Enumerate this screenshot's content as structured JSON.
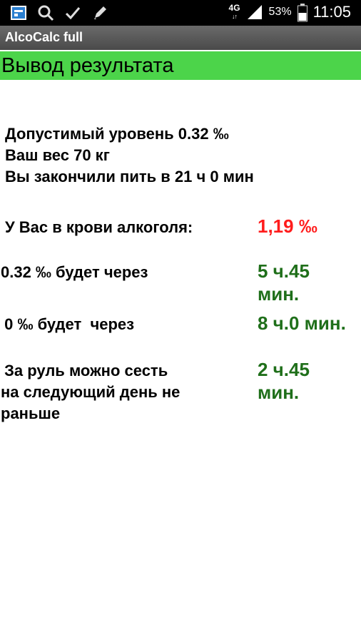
{
  "status_bar": {
    "network": "4G",
    "battery": "53%",
    "time": "11:05",
    "icons": [
      "screenshot-app-icon",
      "search-icon",
      "check-icon",
      "pen-icon",
      "signal-icon",
      "battery-icon"
    ]
  },
  "app": {
    "title": "AlcoCalc full"
  },
  "header": {
    "title": "Вывод результата"
  },
  "inputs_summary": {
    "limit": "Допустимый уровень 0.32  ‰",
    "weight": "Ваш вес 70 кг",
    "finished": "Вы закончили пить в 21 ч 0 мин"
  },
  "results": {
    "blood_label": "У Вас в крови  алкоголя:",
    "blood_value": "1,19  ‰",
    "limit_label": "0.32 ‰ будет  через",
    "limit_value_line1": "5 ч.45",
    "limit_value_line2": "мин.",
    "zero_label": " 0 ‰ будет  через",
    "zero_value": "8 ч.0 мин.",
    "drive_label_line1": " За руль можно сесть",
    "drive_label_line2": "на следующий день не",
    "drive_label_line3": "раньше",
    "drive_value_line1": "2 ч.45",
    "drive_value_line2": "мин."
  },
  "colors": {
    "header_green": "#4cd44a",
    "value_red": "#ff1c1c",
    "value_green": "#1f6f1a"
  }
}
